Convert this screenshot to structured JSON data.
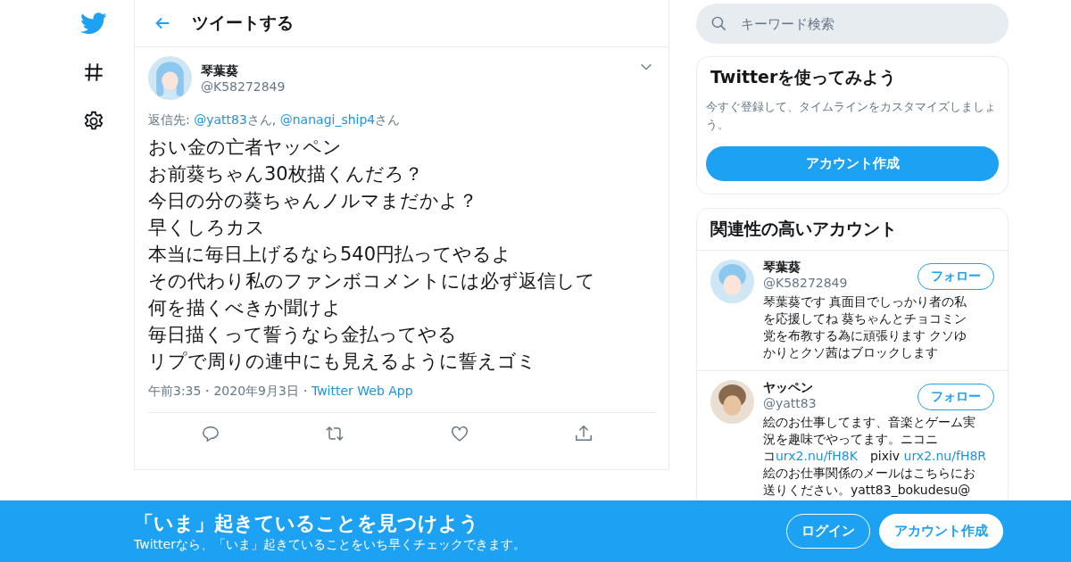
{
  "header": {
    "title": "ツイートする"
  },
  "tweet": {
    "name": "琴葉葵",
    "handle": "@K58272849",
    "reply_to": [
      {
        "kind": "text",
        "text": "返信先: "
      },
      {
        "kind": "link",
        "text": "@yatt83"
      },
      {
        "kind": "text",
        "text": "さん, "
      },
      {
        "kind": "link",
        "text": "@nanagi_ship4"
      },
      {
        "kind": "text",
        "text": "さん"
      }
    ],
    "lines": [
      "おい金の亡者ヤッペン",
      "お前葵ちゃん30枚描くんだろ？",
      "今日の分の葵ちゃんノルマまだかよ？",
      "早くしろカス",
      "本当に毎日上げるなら540円払ってやるよ",
      "その代わり私のファンボコメントには必ず返信して",
      "何を描くべきか聞けよ",
      "毎日描くって誓うなら金払ってやる",
      "リプで周りの連中にも見えるように誓えゴミ"
    ],
    "meta": [
      {
        "kind": "time",
        "text": "午前3:35"
      },
      {
        "kind": "sep",
        "text": "・"
      },
      {
        "kind": "date",
        "text": "2020年9月3日"
      },
      {
        "kind": "sep",
        "text": "・"
      },
      {
        "kind": "link",
        "text": "Twitter Web App"
      }
    ]
  },
  "search": {
    "placeholder": "キーワード検索"
  },
  "signup_card": {
    "title": "Twitterを使ってみよう",
    "text": "今すぐ登録して、タイムラインをカスタマイズしましょう。",
    "button": "アカウント作成"
  },
  "related": {
    "title": "関連性の高いアカウント",
    "accounts": [
      {
        "name": "琴葉葵",
        "handle": "@K58272849",
        "follow": "フォロー",
        "bio": [
          [
            {
              "kind": "text",
              "text": "琴葉葵です 真面目でしっかり者の私"
            }
          ],
          [
            {
              "kind": "text",
              "text": "を応援してね 葵ちゃんとチョコミン"
            }
          ],
          [
            {
              "kind": "text",
              "text": "党を布教する為に頑張ります クソゆ"
            }
          ],
          [
            {
              "kind": "text",
              "text": "かりとクソ茜はブロックします"
            }
          ]
        ]
      },
      {
        "name": "ヤッペン",
        "handle": "@yatt83",
        "follow": "フォロー",
        "bio": [
          [
            {
              "kind": "text",
              "text": "絵のお仕事してます、音楽とゲーム実"
            }
          ],
          [
            {
              "kind": "text",
              "text": "況を趣味でやってます。ニコニ"
            }
          ],
          [
            {
              "kind": "text",
              "text": "コ"
            },
            {
              "kind": "link",
              "text": "urx2.nu/fH8K"
            },
            {
              "kind": "text",
              "text": "　pixiv "
            },
            {
              "kind": "link",
              "text": "urx2.nu/fH8R"
            }
          ],
          [
            {
              "kind": "text",
              "text": "絵のお仕事関係のメールはこちらにお"
            }
          ],
          [
            {
              "kind": "text",
              "text": "送りください。yatt83_bokudesu@"
            }
          ]
        ]
      }
    ]
  },
  "banner": {
    "title": "「いま」起きていることを見つけよう",
    "text": "Twitterなら、「いま」起きていることをいち早くチェックできます。",
    "login": "ログイン",
    "signup": "アカウント作成"
  }
}
